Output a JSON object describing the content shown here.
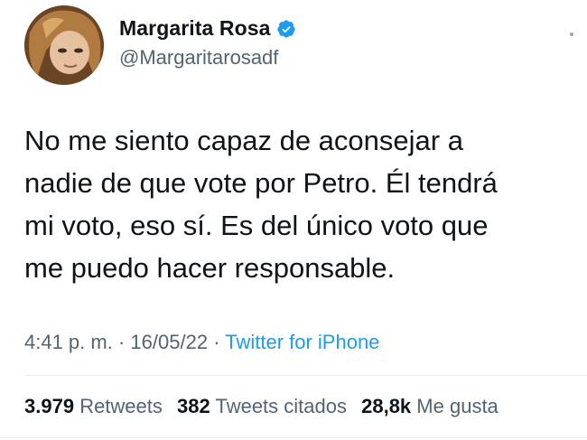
{
  "author": {
    "display_name": "Margarita Rosa",
    "handle": "@Margaritarosadf",
    "verified": true,
    "verified_color": "#1d9bf0"
  },
  "tweet": {
    "text": "No me siento capaz de aconsejar a\nnadie de que vote por Petro. Él tendrá\nmi voto, eso sí. Es del único voto que\nme puedo hacer responsable."
  },
  "meta": {
    "time": "4:41 p. m.",
    "separator": "·",
    "date": "16/05/22",
    "separator2": "·",
    "source": "Twitter for iPhone"
  },
  "stats": {
    "retweets_count": "3.979",
    "retweets_label": "Retweets",
    "quotes_count": "382",
    "quotes_label": "Tweets citados",
    "likes_count": "28,8k",
    "likes_label": "Me gusta"
  },
  "colors": {
    "text": "#0f1419",
    "secondary": "#536471",
    "link": "#1d9bf0"
  }
}
